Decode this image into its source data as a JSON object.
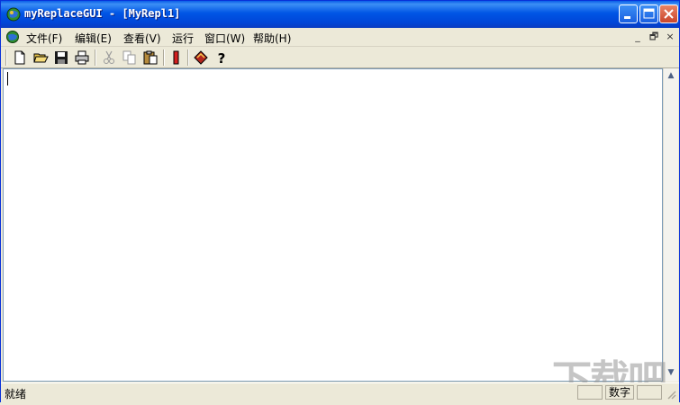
{
  "window": {
    "title": "myReplaceGUI - [MyRepl1]",
    "app_icon": "globe-icon",
    "controls": {
      "minimize": "minimize-icon",
      "maximize": "maximize-icon",
      "close": "close-icon"
    }
  },
  "menubar": {
    "items": [
      {
        "label": "文件(F)"
      },
      {
        "label": "编辑(E)"
      },
      {
        "label": "查看(V)"
      },
      {
        "label": "运行"
      },
      {
        "label": "窗口(W)"
      },
      {
        "label": "帮助(H)"
      }
    ],
    "mdi_controls": [
      "_",
      "🗗",
      "×"
    ]
  },
  "toolbar": {
    "buttons": [
      "new-file-icon",
      "open-folder-icon",
      "save-icon",
      "print-icon",
      "cut-icon",
      "copy-icon",
      "paste-icon",
      "run-icon",
      "book-icon",
      "help-icon"
    ]
  },
  "statusbar": {
    "text": "就绪",
    "num_indicator": "数字"
  },
  "watermark": {
    "text": "下载吧"
  },
  "colors": {
    "title_blue": "#0055e5",
    "face": "#ece9d8",
    "close_red": "#c9452a"
  }
}
